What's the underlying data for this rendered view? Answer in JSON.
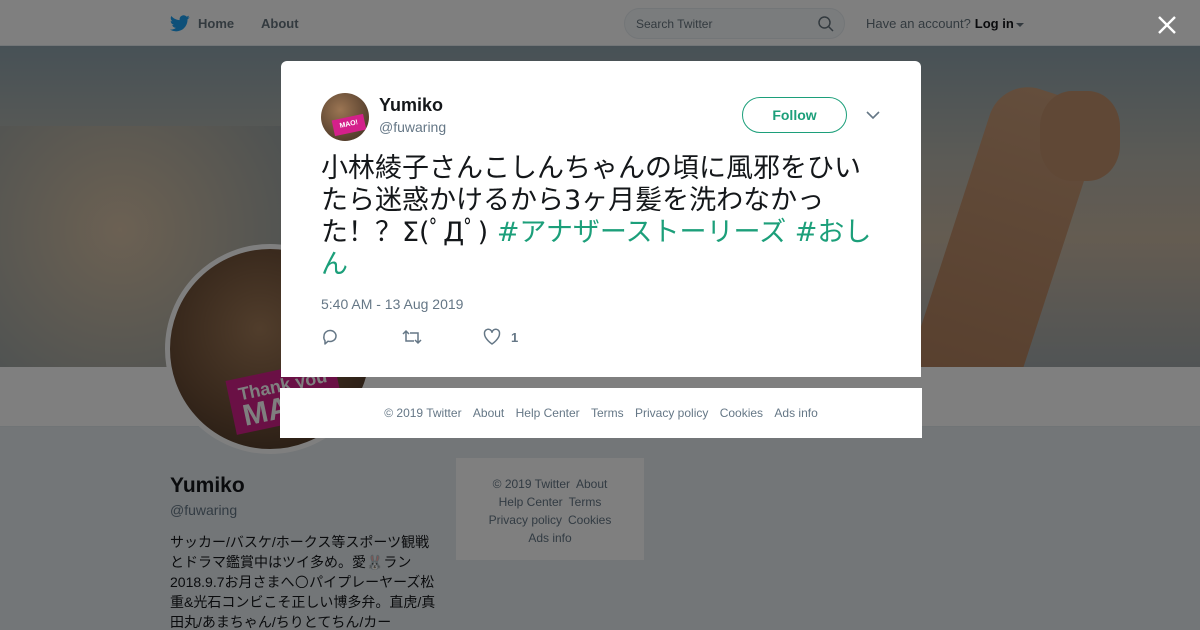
{
  "nav": {
    "home": "Home",
    "about": "About",
    "search_placeholder": "Search Twitter",
    "have_account": "Have an account?",
    "login": "Log in"
  },
  "profile": {
    "name": "Yumiko",
    "handle": "@fuwaring",
    "bio": "サッカー/バスケ/ホークス等スポーツ観戦とドラマ鑑賞中はツイ多め。愛🐰ラン2018.9.7お月さまへ🌕パイプレーヤーズ松重&光石コンビこそ正しい博多弁。直虎/真田丸/あまちゃん/ちりとてちん/カー",
    "avatar_tag_small": "Thank you",
    "avatar_tag_big": "MAO!"
  },
  "sidebar_footer": {
    "links": [
      "© 2019 Twitter",
      "About",
      "Help Center",
      "Terms",
      "Privacy policy",
      "Cookies",
      "Ads info"
    ]
  },
  "tweet": {
    "name": "Yumiko",
    "handle": "@fuwaring",
    "follow_label": "Follow",
    "text": "小林綾子さんこしんちゃんの頃に風邪をひいたら迷惑かけるから3ヶ月髪を洗わなかった！？Σ(ﾟДﾟ) ",
    "hashtag1": "#アナザーストーリーズ",
    "hashtag2": "#おしん",
    "timestamp": "5:40 AM - 13 Aug 2019",
    "like_count": "1",
    "avatar_tag": "MAO!"
  },
  "modal_footer": {
    "links": [
      "© 2019 Twitter",
      "About",
      "Help Center",
      "Terms",
      "Privacy policy",
      "Cookies",
      "Ads info"
    ]
  },
  "colors": {
    "accent": "#1c9f7a",
    "twitter_blue": "#1da1f2",
    "magenta_tag": "#d4208b"
  },
  "icons": {
    "logo": "twitter-bird-icon",
    "search": "search-icon",
    "close": "close-icon",
    "chevron": "chevron-down-icon",
    "reply": "reply-icon",
    "retweet": "retweet-icon",
    "like": "heart-icon"
  }
}
